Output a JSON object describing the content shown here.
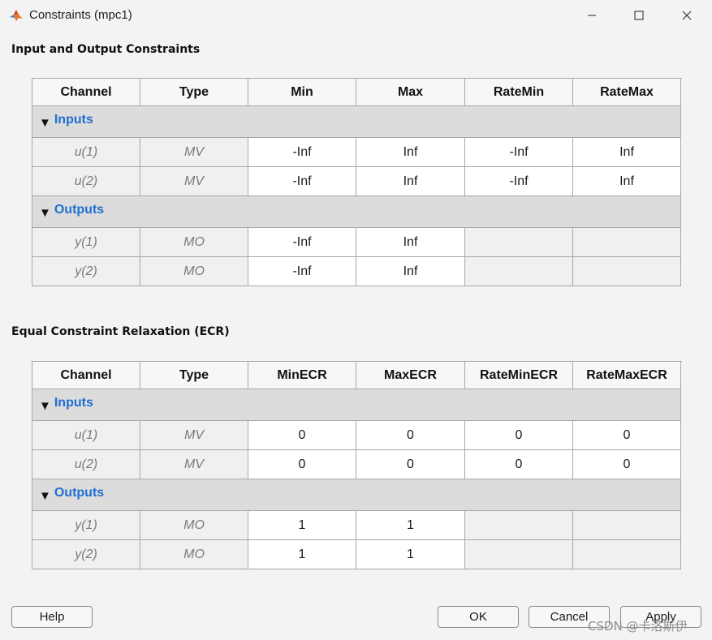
{
  "window": {
    "title": "Constraints (mpc1)",
    "icon": "matlab-logo-icon",
    "controls": [
      "minimize-icon",
      "maximize-icon",
      "close-icon"
    ]
  },
  "io_section": {
    "title": "Input and Output Constraints",
    "headers": [
      "Channel",
      "Type",
      "Min",
      "Max",
      "RateMin",
      "RateMax"
    ],
    "inputs_label": "Inputs",
    "inputs": [
      {
        "channel": "u(1)",
        "type": "MV",
        "min": "-Inf",
        "max": "Inf",
        "ratemin": "-Inf",
        "ratemax": "Inf"
      },
      {
        "channel": "u(2)",
        "type": "MV",
        "min": "-Inf",
        "max": "Inf",
        "ratemin": "-Inf",
        "ratemax": "Inf"
      }
    ],
    "outputs_label": "Outputs",
    "outputs": [
      {
        "channel": "y(1)",
        "type": "MO",
        "min": "-Inf",
        "max": "Inf"
      },
      {
        "channel": "y(2)",
        "type": "MO",
        "min": "-Inf",
        "max": "Inf"
      }
    ]
  },
  "ecr_section": {
    "title": "Equal Constraint Relaxation (ECR)",
    "headers": [
      "Channel",
      "Type",
      "MinECR",
      "MaxECR",
      "RateMinECR",
      "RateMaxECR"
    ],
    "inputs_label": "Inputs",
    "inputs": [
      {
        "channel": "u(1)",
        "type": "MV",
        "min": "0",
        "max": "0",
        "ratemin": "0",
        "ratemax": "0"
      },
      {
        "channel": "u(2)",
        "type": "MV",
        "min": "0",
        "max": "0",
        "ratemin": "0",
        "ratemax": "0"
      }
    ],
    "outputs_label": "Outputs",
    "outputs": [
      {
        "channel": "y(1)",
        "type": "MO",
        "min": "1",
        "max": "1"
      },
      {
        "channel": "y(2)",
        "type": "MO",
        "min": "1",
        "max": "1"
      }
    ]
  },
  "buttons": {
    "help": "Help",
    "ok": "OK",
    "cancel": "Cancel",
    "apply": "Apply"
  },
  "watermark": "CSDN @卡洛斯伊",
  "colors": {
    "group_label": "#1f6fd1",
    "group_bg": "#dcdcdc",
    "readonly_text": "#7a7a7a"
  }
}
